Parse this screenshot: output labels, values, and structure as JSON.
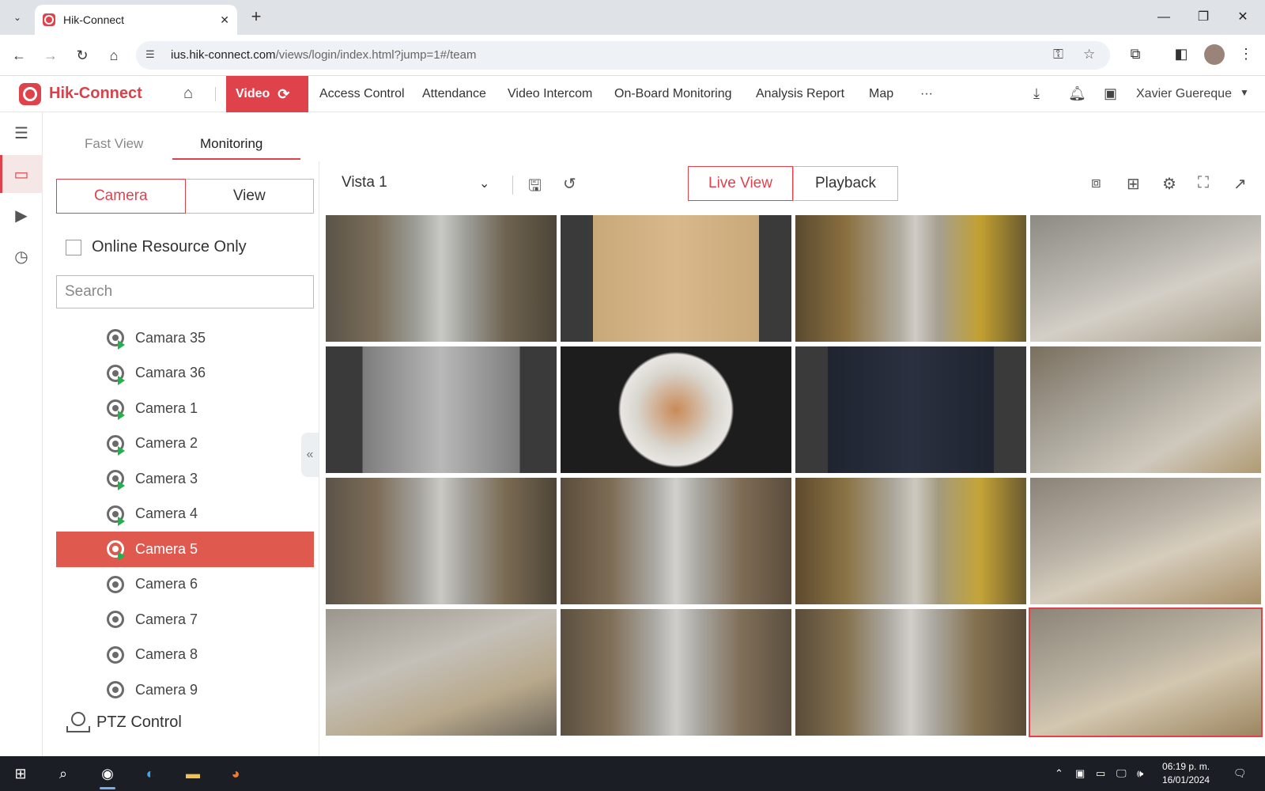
{
  "browser": {
    "tab_title": "Hik-Connect",
    "url_host": "ius.hik-connect.com",
    "url_path": "/views/login/index.html?jump=1#/team"
  },
  "app": {
    "logo": "Hik-Connect",
    "nav": {
      "video": "Video",
      "items": [
        "Access Control",
        "Attendance",
        "Video Intercom",
        "On-Board Monitoring",
        "Analysis Report",
        "Map"
      ],
      "more": "···"
    },
    "user": "Xavier Guereque"
  },
  "subtabs": [
    "Fast View",
    "Monitoring"
  ],
  "panel": {
    "segment": [
      "Camera",
      "View"
    ],
    "online_only_label": "Online Resource Only",
    "search_placeholder": "Search",
    "cameras": [
      {
        "name": "Camara 35",
        "online": true
      },
      {
        "name": "Camara 36",
        "online": true
      },
      {
        "name": "Camera 1",
        "online": true
      },
      {
        "name": "Camera 2",
        "online": true
      },
      {
        "name": "Camera 3",
        "online": true
      },
      {
        "name": "Camera 4",
        "online": true
      },
      {
        "name": "Camera 5",
        "online": true,
        "selected": true
      },
      {
        "name": "Camera 6",
        "online": false
      },
      {
        "name": "Camera 7",
        "online": false
      },
      {
        "name": "Camera 8",
        "online": false
      },
      {
        "name": "Camera 9",
        "online": false
      }
    ],
    "ptz_label": "PTZ Control"
  },
  "toolbar": {
    "view_name": "Vista 1",
    "live_view": "Live View",
    "playback": "Playback"
  },
  "taskbar": {
    "time": "06:19 p. m.",
    "date": "16/01/2024"
  },
  "colors": {
    "accent": "#e0424b",
    "selected_row": "#e0594f",
    "online_play": "#22b14c"
  }
}
